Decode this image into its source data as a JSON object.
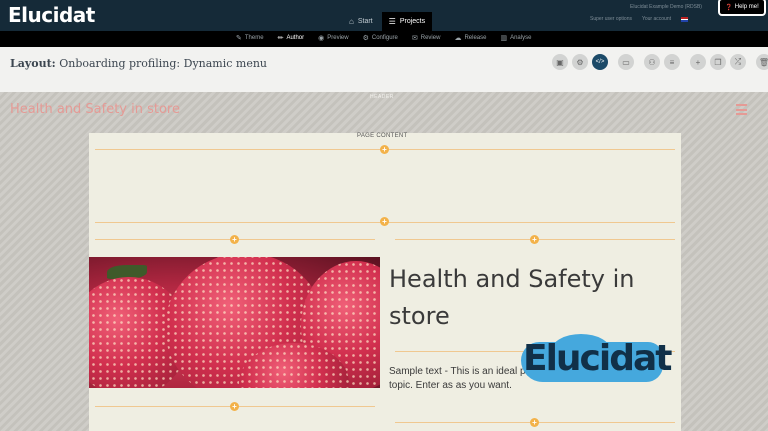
{
  "app": {
    "logo_text": "Elucidat"
  },
  "top_nav": [
    {
      "label": "Start",
      "icon": "home-icon",
      "glyph": "⌂",
      "active": false
    },
    {
      "label": "Projects",
      "icon": "list-icon",
      "glyph": "☰",
      "active": true
    }
  ],
  "account": {
    "company": "Elucidat Example Demo (RDSB)",
    "links": [
      "Super user options",
      "Your account"
    ],
    "help_label": "Help me!"
  },
  "modes": [
    {
      "label": "Theme",
      "glyph": "✎",
      "icon": "brush-icon",
      "active": false
    },
    {
      "label": "Author",
      "glyph": "✏",
      "icon": "pencil-icon",
      "active": true
    },
    {
      "label": "Preview",
      "glyph": "◉",
      "icon": "eye-icon",
      "active": false
    },
    {
      "label": "Configure",
      "glyph": "⚙",
      "icon": "gears-icon",
      "active": false
    },
    {
      "label": "Review",
      "glyph": "✉",
      "icon": "comment-icon",
      "active": false
    },
    {
      "label": "Release",
      "glyph": "☁",
      "icon": "cloud-icon",
      "active": false
    },
    {
      "label": "Analyse",
      "glyph": "▥",
      "icon": "chart-icon",
      "active": false
    }
  ],
  "layout": {
    "prefix": "Layout:",
    "name": "Onboarding profiling: Dynamic menu"
  },
  "tools": [
    {
      "icon": "save-icon",
      "glyph": "▣",
      "active": false,
      "gap": false
    },
    {
      "icon": "settings-icon",
      "glyph": "⚙",
      "active": false,
      "gap": false
    },
    {
      "icon": "code-icon",
      "glyph": "&lt;/&gt;",
      "label": "",
      "active": true,
      "gap": false
    },
    {
      "icon": "desktop-icon",
      "glyph": "▭",
      "active": false,
      "gap": true
    },
    {
      "icon": "hierarchy-icon",
      "glyph": "⚇",
      "active": false,
      "gap": true
    },
    {
      "icon": "list-icon",
      "glyph": "≡",
      "active": false,
      "gap": false
    },
    {
      "icon": "add-icon",
      "glyph": "+",
      "active": false,
      "gap": true
    },
    {
      "icon": "copy-icon",
      "glyph": "❐",
      "active": false,
      "gap": false
    },
    {
      "icon": "shuffle-icon",
      "glyph": "⤮",
      "active": false,
      "gap": false
    },
    {
      "icon": "trash-icon",
      "glyph": "🗑",
      "active": false,
      "gap": true
    }
  ],
  "stage": {
    "header_label": "HEADER",
    "page_heading": "Health and Safety in store",
    "page_content_label": "PAGE CONTENT",
    "content_title": "Health and Safety in store",
    "content_body": "Sample text - This is an ideal place understanding of your topic. Enter as as you want."
  },
  "brand": {
    "text": "Elucidat"
  },
  "colors": {
    "topbar": "#152a38",
    "accent_blue": "#1c4a68",
    "add_orange": "#f3b24a",
    "heading_pink": "#e59a95"
  }
}
